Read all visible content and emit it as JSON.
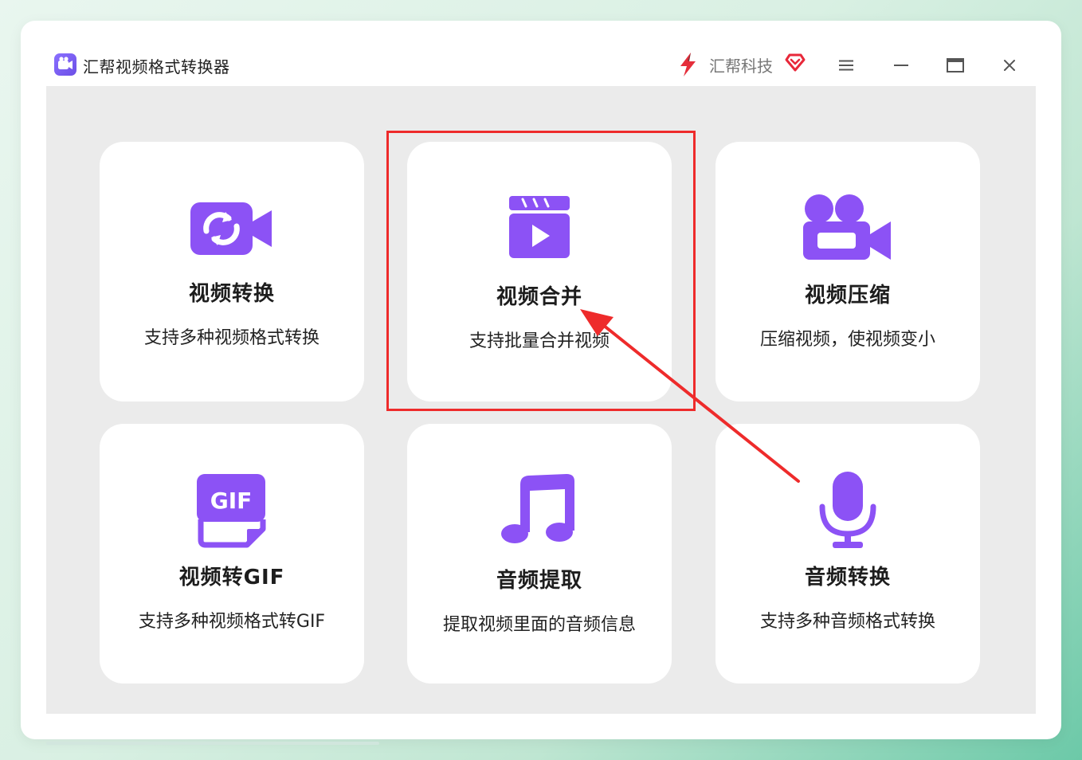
{
  "app": {
    "title": "汇帮视频格式转换器",
    "brand_name": "汇帮科技"
  },
  "icons": {
    "app_logo": "video-camera-icon",
    "brand_logo": "lightning-icon",
    "vip": "heart-diamond-icon",
    "menu": "hamburger-menu-icon",
    "minimize": "minimize-icon",
    "maximize": "maximize-icon",
    "close": "close-icon"
  },
  "colors": {
    "accent": "#8c52f5",
    "annotation": "#ee2b2b",
    "content_bg": "#ebebeb"
  },
  "cards": [
    {
      "title": "视频转换",
      "desc": "支持多种视频格式转换",
      "icon": "video-convert-icon"
    },
    {
      "title": "视频合并",
      "desc": "支持批量合并视频",
      "icon": "video-merge-clapper-icon"
    },
    {
      "title": "视频压缩",
      "desc": "压缩视频，使视频变小",
      "icon": "video-compress-camera-icon"
    },
    {
      "title": "视频转GIF",
      "desc": "支持多种视频格式转GIF",
      "icon": "gif-file-icon",
      "icon_text": "GIF"
    },
    {
      "title": "音频提取",
      "desc": "提取视频里面的音频信息",
      "icon": "music-note-icon"
    },
    {
      "title": "音频转换",
      "desc": "支持多种音频格式转换",
      "icon": "microphone-icon"
    }
  ]
}
